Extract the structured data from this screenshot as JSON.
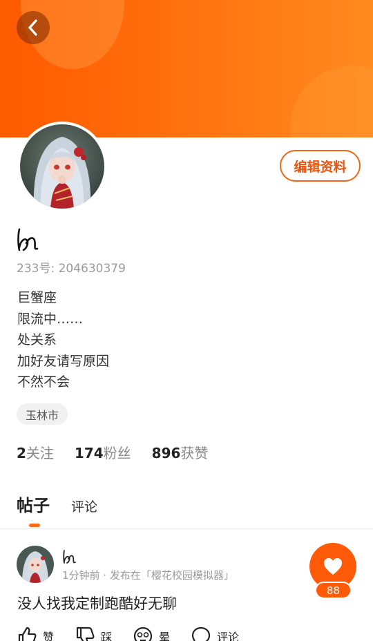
{
  "profile": {
    "uid_label": "233号: 204630379",
    "bio_lines": [
      "巨蟹座",
      "限流中……",
      "处关系",
      "加好友请写原因",
      "不然不会"
    ],
    "city": "玉林市",
    "edit_label": "编辑资料"
  },
  "stats": {
    "following": {
      "num": "2",
      "label": "关注"
    },
    "followers": {
      "num": "174",
      "label": "粉丝"
    },
    "likes": {
      "num": "896",
      "label": "获赞"
    }
  },
  "tabs": {
    "posts": "帖子",
    "comments": "评论"
  },
  "post": {
    "meta": "1分钟前 · 发布在「樱花校园模拟器」",
    "text": "没人找我定制跑酷好无聊",
    "like_count": "88",
    "actions": {
      "like": "赞",
      "dislike": "踩",
      "dizzy": "晕",
      "comment": "评论"
    }
  },
  "colors": {
    "brand_orange": "#ff5a08",
    "banner_end": "#ff8a20"
  }
}
